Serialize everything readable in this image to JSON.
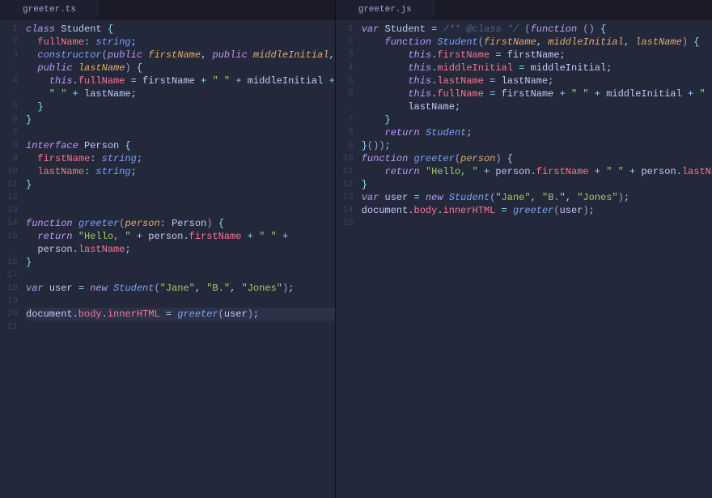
{
  "left": {
    "tab": "greeter.ts",
    "gutter": [
      "1",
      "2",
      "3",
      "·",
      "4",
      "·",
      "5",
      "6",
      "7",
      "8",
      "9",
      "10",
      "11",
      "12",
      "13",
      "14",
      "15",
      "·",
      "16",
      "17",
      "18",
      "19",
      "20",
      "21"
    ],
    "lines": [
      [
        [
          "kw",
          "class "
        ],
        [
          "cls",
          "Student "
        ],
        [
          "punc",
          "{"
        ]
      ],
      [
        [
          "plain",
          "  "
        ],
        [
          "prop",
          "fullName"
        ],
        [
          "op",
          ": "
        ],
        [
          "fn",
          "string"
        ],
        [
          "punc",
          ";"
        ]
      ],
      [
        [
          "plain",
          "  "
        ],
        [
          "fn",
          "constructor"
        ],
        [
          "paren",
          "("
        ],
        [
          "kw",
          "public "
        ],
        [
          "param",
          "firstName"
        ],
        [
          "punc",
          ", "
        ],
        [
          "kw",
          "public "
        ],
        [
          "param",
          "middleInitial"
        ],
        [
          "punc",
          ","
        ]
      ],
      [
        [
          "plain",
          "  "
        ],
        [
          "kw",
          "public "
        ],
        [
          "param",
          "lastName"
        ],
        [
          "paren",
          ") "
        ],
        [
          "punc",
          "{"
        ]
      ],
      [
        [
          "plain",
          "    "
        ],
        [
          "kw",
          "this"
        ],
        [
          "punc",
          "."
        ],
        [
          "prop",
          "fullName"
        ],
        [
          "op",
          " = "
        ],
        [
          "var",
          "firstName"
        ],
        [
          "op",
          " + "
        ],
        [
          "str",
          "\" \""
        ],
        [
          "op",
          " + "
        ],
        [
          "var",
          "middleInitial"
        ],
        [
          "op",
          " +"
        ]
      ],
      [
        [
          "plain",
          "    "
        ],
        [
          "str",
          "\" \""
        ],
        [
          "op",
          " + "
        ],
        [
          "var",
          "lastName"
        ],
        [
          "punc",
          ";"
        ]
      ],
      [
        [
          "plain",
          "  "
        ],
        [
          "punc",
          "}"
        ]
      ],
      [
        [
          "punc",
          "}"
        ]
      ],
      [
        [
          "plain",
          ""
        ]
      ],
      [
        [
          "kw",
          "interface "
        ],
        [
          "cls",
          "Person "
        ],
        [
          "punc",
          "{"
        ]
      ],
      [
        [
          "plain",
          "  "
        ],
        [
          "prop",
          "firstName"
        ],
        [
          "op",
          ": "
        ],
        [
          "fn",
          "string"
        ],
        [
          "punc",
          ";"
        ]
      ],
      [
        [
          "plain",
          "  "
        ],
        [
          "prop",
          "lastName"
        ],
        [
          "op",
          ": "
        ],
        [
          "fn",
          "string"
        ],
        [
          "punc",
          ";"
        ]
      ],
      [
        [
          "punc",
          "}"
        ]
      ],
      [
        [
          "plain",
          ""
        ]
      ],
      [
        [
          "plain",
          ""
        ]
      ],
      [
        [
          "kw",
          "function "
        ],
        [
          "fn",
          "greeter"
        ],
        [
          "paren",
          "("
        ],
        [
          "param",
          "person"
        ],
        [
          "op",
          ": "
        ],
        [
          "cls",
          "Person"
        ],
        [
          "paren",
          ") "
        ],
        [
          "punc",
          "{"
        ]
      ],
      [
        [
          "plain",
          "  "
        ],
        [
          "kw",
          "return "
        ],
        [
          "str",
          "\"Hello, \""
        ],
        [
          "op",
          " + "
        ],
        [
          "var",
          "person"
        ],
        [
          "punc",
          "."
        ],
        [
          "prop",
          "firstName"
        ],
        [
          "op",
          " + "
        ],
        [
          "str",
          "\" \""
        ],
        [
          "op",
          " +"
        ]
      ],
      [
        [
          "plain",
          "  "
        ],
        [
          "var",
          "person"
        ],
        [
          "punc",
          "."
        ],
        [
          "prop",
          "lastName"
        ],
        [
          "punc",
          ";"
        ]
      ],
      [
        [
          "punc",
          "}"
        ]
      ],
      [
        [
          "plain",
          ""
        ]
      ],
      [
        [
          "kw",
          "var "
        ],
        [
          "var",
          "user"
        ],
        [
          "op",
          " = "
        ],
        [
          "kw",
          "new "
        ],
        [
          "fn",
          "Student"
        ],
        [
          "paren",
          "("
        ],
        [
          "str",
          "\"Jane\""
        ],
        [
          "punc",
          ", "
        ],
        [
          "str",
          "\"B.\""
        ],
        [
          "punc",
          ", "
        ],
        [
          "str",
          "\"Jones\""
        ],
        [
          "paren",
          ")"
        ],
        [
          "punc",
          ";"
        ]
      ],
      [
        [
          "plain",
          ""
        ]
      ],
      [
        [
          "var",
          "document"
        ],
        [
          "punc",
          "."
        ],
        [
          "prop",
          "body"
        ],
        [
          "punc",
          "."
        ],
        [
          "prop",
          "innerHTML"
        ],
        [
          "op",
          " = "
        ],
        [
          "fn",
          "greeter"
        ],
        [
          "paren",
          "("
        ],
        [
          "var",
          "user"
        ],
        [
          "paren",
          ")"
        ],
        [
          "punc",
          ";"
        ]
      ],
      [
        [
          "plain",
          ""
        ]
      ]
    ],
    "cursorLine": 22
  },
  "right": {
    "tab": "greeter.js",
    "gutter": [
      "1",
      "2",
      "3",
      "4",
      "5",
      "6",
      "·",
      "7",
      "8",
      "9",
      "10",
      "11",
      "12",
      "13",
      "14",
      "15"
    ],
    "lines": [
      [
        [
          "kw",
          "var "
        ],
        [
          "var",
          "Student"
        ],
        [
          "op",
          " = "
        ],
        [
          "comm",
          "/** @class */"
        ],
        [
          "plain",
          " "
        ],
        [
          "paren",
          "("
        ],
        [
          "kw",
          "function "
        ],
        [
          "paren",
          "() "
        ],
        [
          "punc",
          "{"
        ]
      ],
      [
        [
          "plain",
          "    "
        ],
        [
          "kw",
          "function "
        ],
        [
          "fn",
          "Student"
        ],
        [
          "paren",
          "("
        ],
        [
          "param",
          "firstName"
        ],
        [
          "punc",
          ", "
        ],
        [
          "param",
          "middleInitial"
        ],
        [
          "punc",
          ", "
        ],
        [
          "param",
          "lastName"
        ],
        [
          "paren",
          ") "
        ],
        [
          "punc",
          "{"
        ]
      ],
      [
        [
          "plain",
          "        "
        ],
        [
          "kw",
          "this"
        ],
        [
          "punc",
          "."
        ],
        [
          "prop",
          "firstName"
        ],
        [
          "op",
          " = "
        ],
        [
          "var",
          "firstName"
        ],
        [
          "punc",
          ";"
        ]
      ],
      [
        [
          "plain",
          "        "
        ],
        [
          "kw",
          "this"
        ],
        [
          "punc",
          "."
        ],
        [
          "prop",
          "middleInitial"
        ],
        [
          "op",
          " = "
        ],
        [
          "var",
          "middleInitial"
        ],
        [
          "punc",
          ";"
        ]
      ],
      [
        [
          "plain",
          "        "
        ],
        [
          "kw",
          "this"
        ],
        [
          "punc",
          "."
        ],
        [
          "prop",
          "lastName"
        ],
        [
          "op",
          " = "
        ],
        [
          "var",
          "lastName"
        ],
        [
          "punc",
          ";"
        ]
      ],
      [
        [
          "plain",
          "        "
        ],
        [
          "kw",
          "this"
        ],
        [
          "punc",
          "."
        ],
        [
          "prop",
          "fullName"
        ],
        [
          "op",
          " = "
        ],
        [
          "var",
          "firstName"
        ],
        [
          "op",
          " + "
        ],
        [
          "str",
          "\" \""
        ],
        [
          "op",
          " + "
        ],
        [
          "var",
          "middleInitial"
        ],
        [
          "op",
          " + "
        ],
        [
          "str",
          "\" \""
        ],
        [
          "op",
          " +"
        ]
      ],
      [
        [
          "plain",
          "        "
        ],
        [
          "var",
          "lastName"
        ],
        [
          "punc",
          ";"
        ]
      ],
      [
        [
          "plain",
          "    "
        ],
        [
          "punc",
          "}"
        ]
      ],
      [
        [
          "plain",
          "    "
        ],
        [
          "kw",
          "return "
        ],
        [
          "fn",
          "Student"
        ],
        [
          "punc",
          ";"
        ]
      ],
      [
        [
          "punc",
          "}"
        ],
        [
          "paren",
          "())"
        ],
        [
          "punc",
          ";"
        ]
      ],
      [
        [
          "kw",
          "function "
        ],
        [
          "fn",
          "greeter"
        ],
        [
          "paren",
          "("
        ],
        [
          "param",
          "person"
        ],
        [
          "paren",
          ") "
        ],
        [
          "punc",
          "{"
        ]
      ],
      [
        [
          "plain",
          "    "
        ],
        [
          "kw",
          "return "
        ],
        [
          "str",
          "\"Hello, \""
        ],
        [
          "op",
          " + "
        ],
        [
          "var",
          "person"
        ],
        [
          "punc",
          "."
        ],
        [
          "prop",
          "firstName"
        ],
        [
          "op",
          " + "
        ],
        [
          "str",
          "\" \""
        ],
        [
          "op",
          " + "
        ],
        [
          "var",
          "person"
        ],
        [
          "punc",
          "."
        ],
        [
          "prop",
          "lastName"
        ],
        [
          "punc",
          ";"
        ]
      ],
      [
        [
          "punc",
          "}"
        ]
      ],
      [
        [
          "kw",
          "var "
        ],
        [
          "var",
          "user"
        ],
        [
          "op",
          " = "
        ],
        [
          "kw",
          "new "
        ],
        [
          "fn",
          "Student"
        ],
        [
          "paren",
          "("
        ],
        [
          "str",
          "\"Jane\""
        ],
        [
          "punc",
          ", "
        ],
        [
          "str",
          "\"B.\""
        ],
        [
          "punc",
          ", "
        ],
        [
          "str",
          "\"Jones\""
        ],
        [
          "paren",
          ")"
        ],
        [
          "punc",
          ";"
        ]
      ],
      [
        [
          "var",
          "document"
        ],
        [
          "punc",
          "."
        ],
        [
          "prop",
          "body"
        ],
        [
          "punc",
          "."
        ],
        [
          "prop",
          "innerHTML"
        ],
        [
          "op",
          " = "
        ],
        [
          "fn",
          "greeter"
        ],
        [
          "paren",
          "("
        ],
        [
          "var",
          "user"
        ],
        [
          "paren",
          ")"
        ],
        [
          "punc",
          ";"
        ]
      ],
      [
        [
          "plain",
          ""
        ]
      ]
    ],
    "cursorLine": -1
  }
}
